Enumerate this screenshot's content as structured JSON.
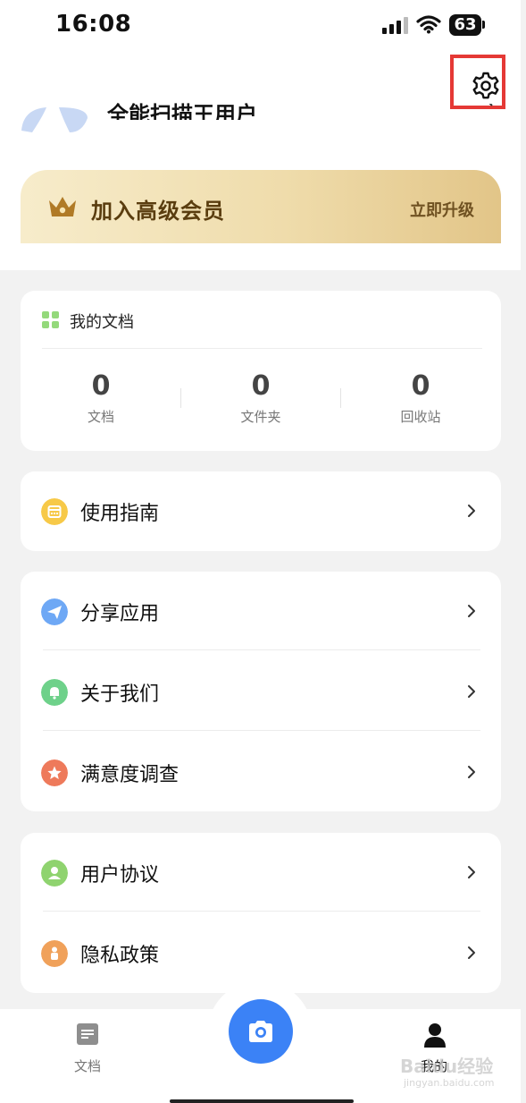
{
  "status_bar": {
    "time": "16:08",
    "battery": "63"
  },
  "header": {
    "settings_icon": "gear-icon",
    "profile_name": "全能扫描王用户",
    "accent": "#e53935"
  },
  "vip": {
    "title": "加入高级会员",
    "action": "立即升级"
  },
  "documents": {
    "title": "我的文档",
    "stats": [
      {
        "value": "0",
        "label": "文档"
      },
      {
        "value": "0",
        "label": "文件夹"
      },
      {
        "value": "0",
        "label": "回收站"
      }
    ]
  },
  "menu_groups": [
    [
      {
        "label": "使用指南",
        "icon": "guide-icon",
        "color": "#f7c948"
      }
    ],
    [
      {
        "label": "分享应用",
        "icon": "paper-plane-icon",
        "color": "#6ea8f5"
      },
      {
        "label": "关于我们",
        "icon": "bell-icon",
        "color": "#6ed18a"
      },
      {
        "label": "满意度调查",
        "icon": "star-icon",
        "color": "#ee7a5b"
      }
    ],
    [
      {
        "label": "用户协议",
        "icon": "user-icon",
        "color": "#8fd36f"
      },
      {
        "label": "隐私政策",
        "icon": "privacy-icon",
        "color": "#f0a15a"
      }
    ]
  ],
  "tab_bar": {
    "tabs": [
      {
        "label": "文档"
      },
      {
        "label": "我的"
      }
    ],
    "camera_color": "#3b82f6"
  },
  "watermark": {
    "logo": "Baidu经验",
    "url": "jingyan.baidu.com"
  }
}
